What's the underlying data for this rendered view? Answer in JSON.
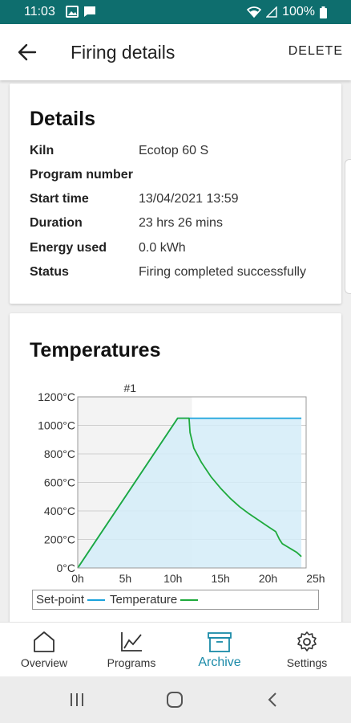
{
  "status_bar": {
    "time": "11:03",
    "battery": "100%"
  },
  "app_bar": {
    "title": "Firing details",
    "action": "DELETE"
  },
  "details": {
    "heading": "Details",
    "rows": [
      {
        "label": "Kiln",
        "value": "Ecotop 60 S"
      },
      {
        "label": "Program number",
        "value": ""
      },
      {
        "label": "Start time",
        "value": "13/04/2021 13:59"
      },
      {
        "label": "Duration",
        "value": "23 hrs 26 mins"
      },
      {
        "label": "Energy used",
        "value": "0.0 kWh"
      },
      {
        "label": "Status",
        "value": "Firing completed successfully"
      }
    ]
  },
  "temperatures": {
    "heading": "Temperatures",
    "legend": {
      "setpoint": "Set-point",
      "temperature": "Temperature"
    }
  },
  "chart_data": {
    "type": "line",
    "marker_label": "#1",
    "xlim": [
      0,
      24
    ],
    "ylim": [
      0,
      1200
    ],
    "x_ticks": [
      0,
      5,
      10,
      15,
      20,
      25
    ],
    "x_tick_labels": [
      "0h",
      "5h",
      "10h",
      "15h",
      "20h",
      "25h"
    ],
    "y_ticks": [
      0,
      200,
      400,
      600,
      800,
      1000,
      1200
    ],
    "y_tick_labels": [
      "0°C",
      "200°C",
      "400°C",
      "600°C",
      "800°C",
      "1000°C",
      "1200°C"
    ],
    "grid": true,
    "legend_position": "bottom",
    "shaded_region_end_x": 12,
    "series": [
      {
        "name": "Set-point",
        "color": "#1aa3dc",
        "fill": "#d4ecf8",
        "x": [
          0,
          10.5,
          11.7,
          23.5
        ],
        "y": [
          0,
          1050,
          1050,
          1050
        ]
      },
      {
        "name": "Temperature",
        "color": "#1eaa3c",
        "x": [
          0,
          10.5,
          11.7,
          11.8,
          12.2,
          13,
          14,
          15,
          16,
          17,
          18,
          19,
          20,
          20.8,
          21.2,
          21.5,
          22,
          22.5,
          23,
          23.5
        ],
        "y": [
          0,
          1050,
          1050,
          950,
          840,
          740,
          640,
          560,
          490,
          430,
          380,
          335,
          290,
          255,
          200,
          170,
          150,
          130,
          110,
          80
        ]
      }
    ]
  },
  "bottom_nav": {
    "items": [
      {
        "label": "Overview",
        "icon": "home-icon"
      },
      {
        "label": "Programs",
        "icon": "chart-icon"
      },
      {
        "label": "Archive",
        "icon": "archive-icon"
      },
      {
        "label": "Settings",
        "icon": "gear-icon"
      }
    ],
    "active_index": 2,
    "active_color": "#1a8aa8"
  },
  "colors": {
    "status_bar": "#0e6e6e",
    "accent": "#1a8aa8"
  }
}
